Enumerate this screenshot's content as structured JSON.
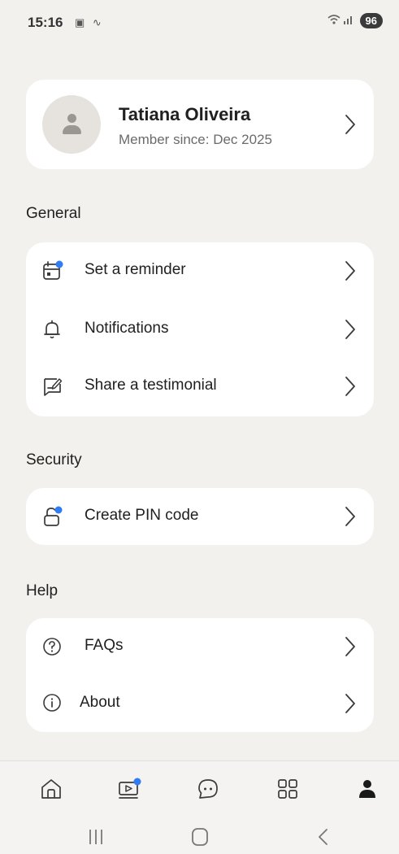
{
  "status_bar": {
    "time": "15:16",
    "battery": "96"
  },
  "profile": {
    "name": "Tatiana Oliveira",
    "member_since": "Member since: Dec 2025"
  },
  "sections": {
    "general": {
      "title": "General",
      "items": [
        {
          "label": "Set a reminder",
          "icon": "calendar-icon",
          "badge": true
        },
        {
          "label": "Notifications",
          "icon": "bell-icon"
        },
        {
          "label": "Share a testimonial",
          "icon": "testimonial-icon"
        }
      ]
    },
    "security": {
      "title": "Security",
      "items": [
        {
          "label": "Create PIN code",
          "icon": "lock-icon",
          "badge": true
        }
      ]
    },
    "help": {
      "title": "Help",
      "items": [
        {
          "label": "FAQs",
          "icon": "question-icon"
        },
        {
          "label": "About",
          "icon": "info-icon"
        }
      ]
    }
  },
  "bottom_nav": {
    "tabs": [
      {
        "icon": "home-icon"
      },
      {
        "icon": "video-icon",
        "badge": true
      },
      {
        "icon": "chat-icon"
      },
      {
        "icon": "grid-icon"
      },
      {
        "icon": "profile-icon",
        "active": true
      }
    ]
  },
  "colors": {
    "background": "#f2f1ee",
    "card": "#ffffff",
    "badge": "#2f7cf6",
    "text": "#1f1f1f",
    "muted": "#6b6b6b"
  }
}
